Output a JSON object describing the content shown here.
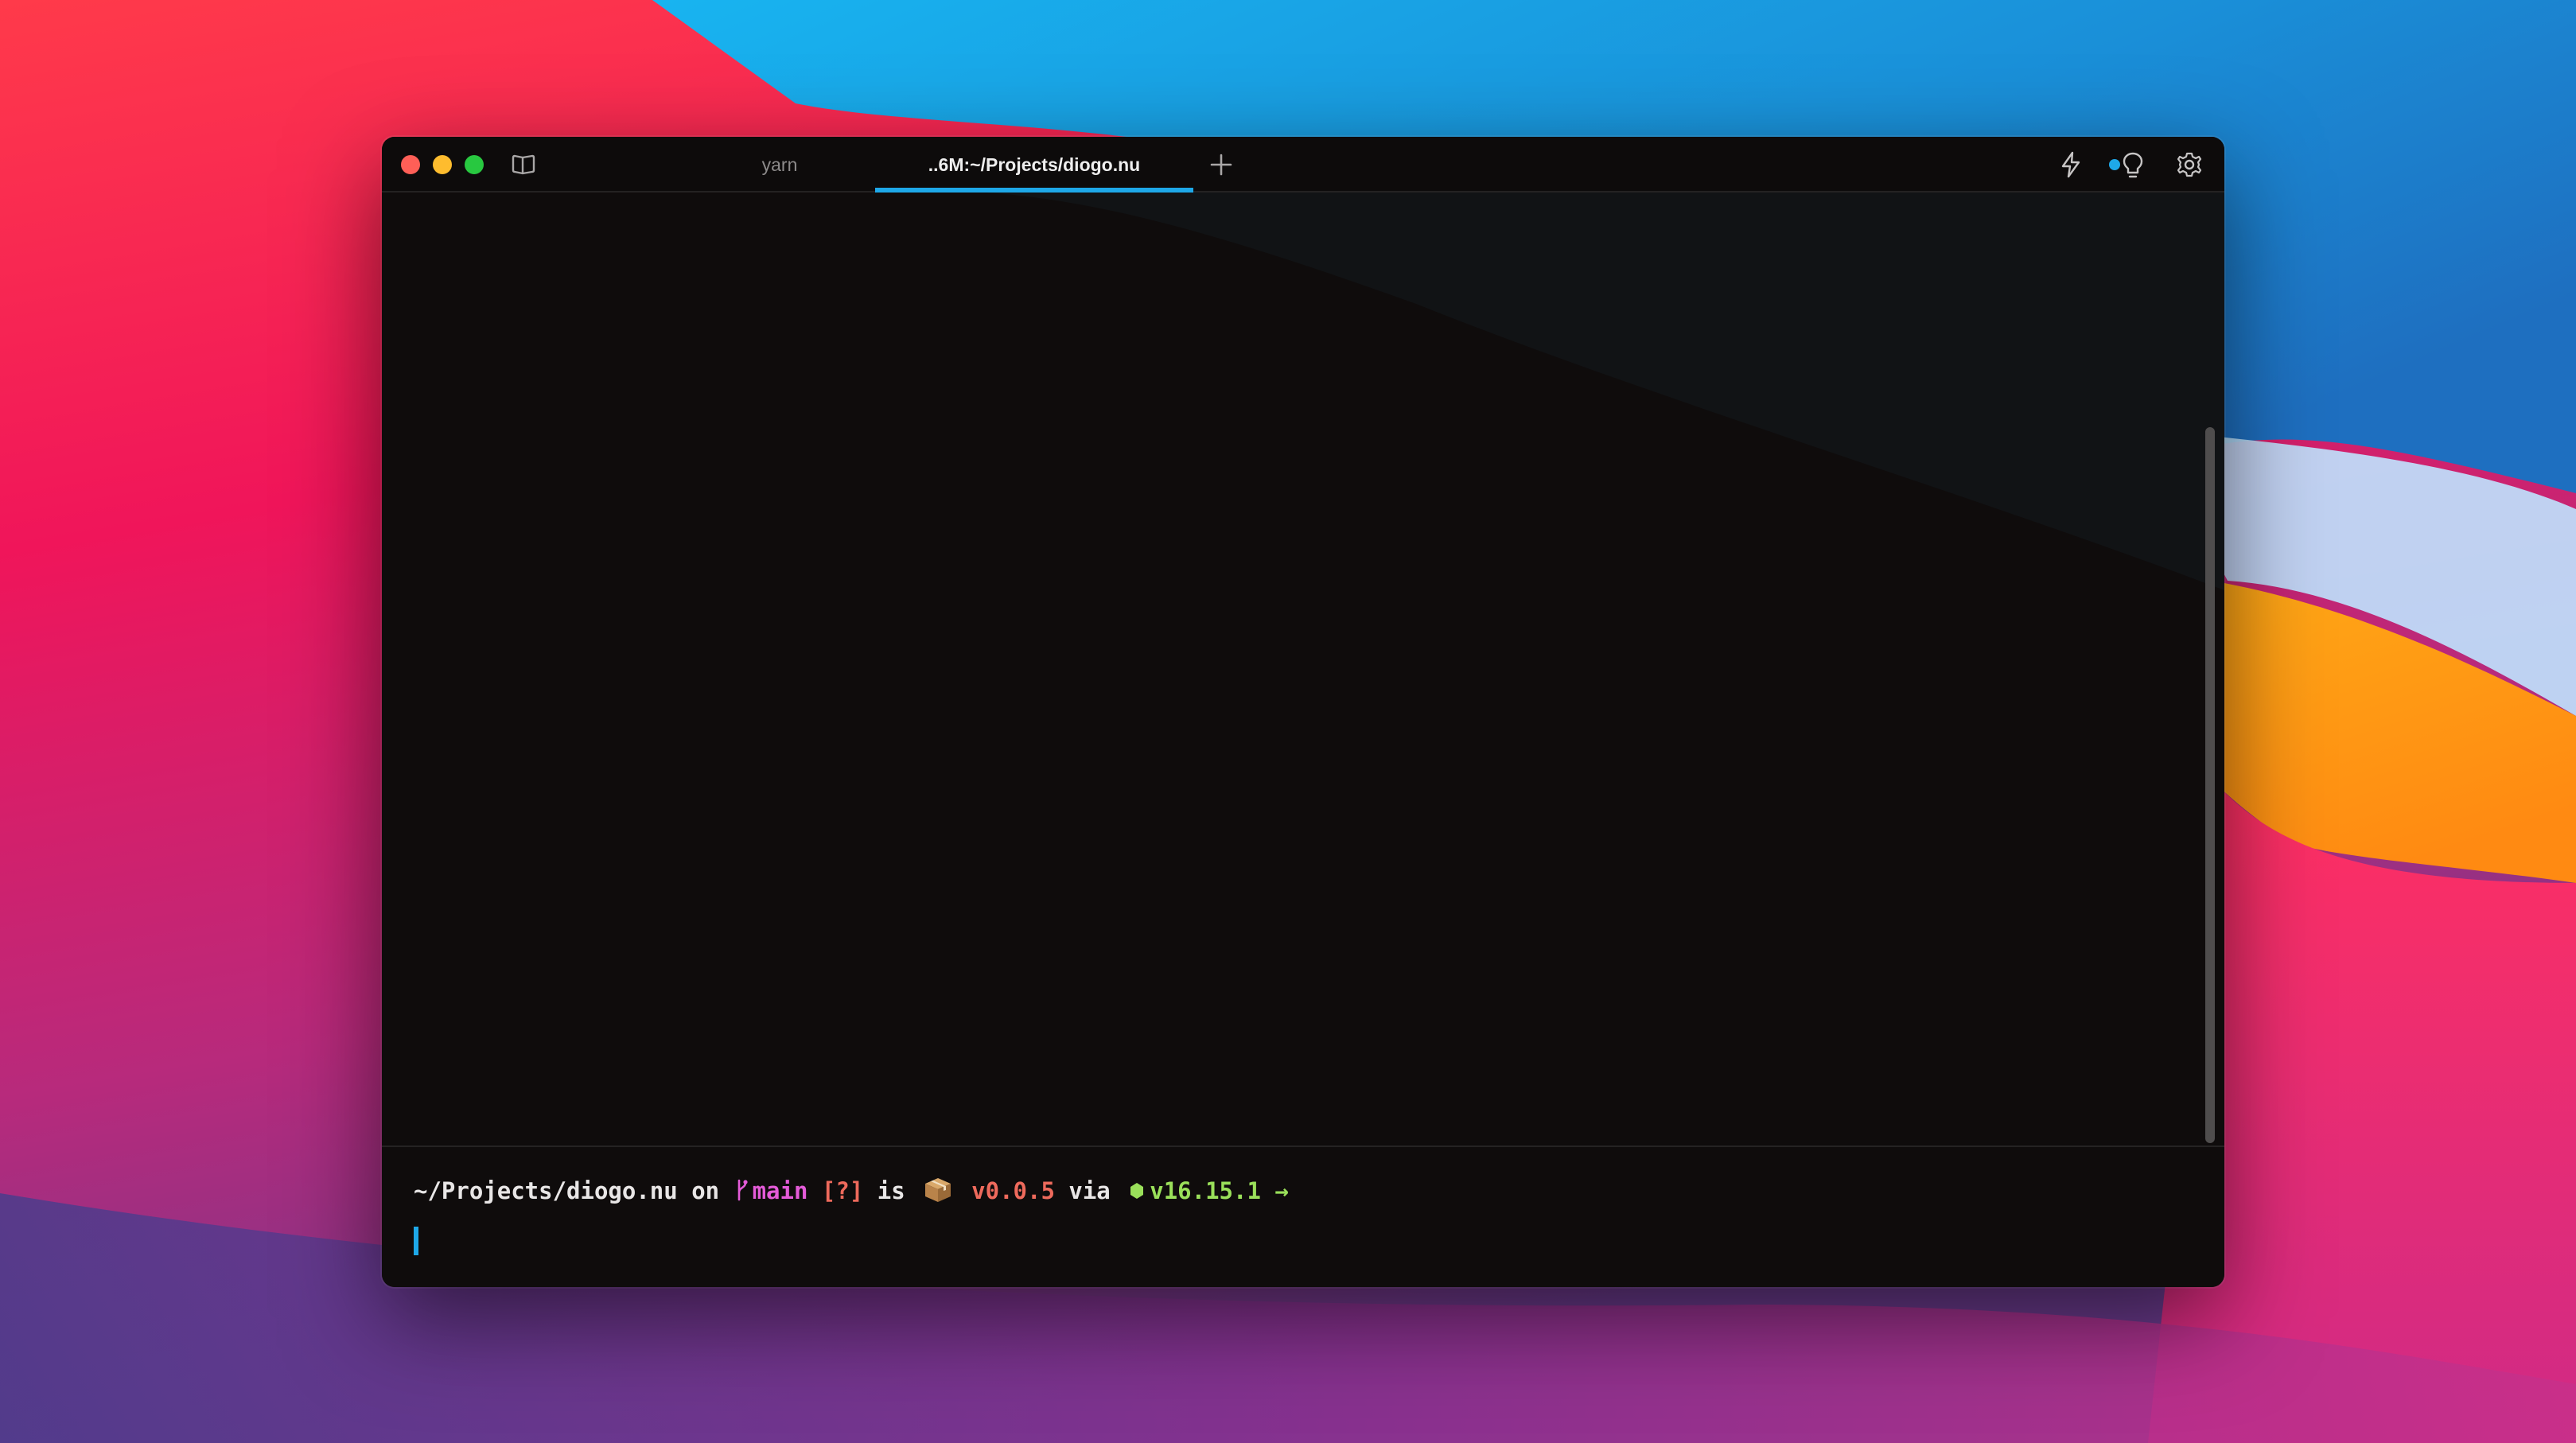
{
  "window": {
    "tabs": [
      {
        "label": "yarn",
        "active": false
      },
      {
        "label": "..6M:~/Projects/diogo.nu",
        "active": true
      }
    ],
    "accent_color": "#1ea8e8"
  },
  "prompt": {
    "path": "~/Projects/diogo.nu",
    "on": "on",
    "branch": "main",
    "status": "[?]",
    "is": "is",
    "package_version": "v0.0.5",
    "via": "via",
    "node_version": "v16.15.1",
    "arrow": "→"
  },
  "icons": [
    "sidebar-icon",
    "plus-icon",
    "lightning-icon",
    "lightbulb-icon",
    "gear-icon",
    "branch-icon",
    "package-icon",
    "node-icon"
  ],
  "colors": {
    "close": "#fe5f57",
    "minimize": "#febc2e",
    "maximize": "#28c840",
    "path": "#e8e6e6",
    "branch": "#e45bd8",
    "version": "#ee6a5c",
    "node": "#9ae05a"
  }
}
